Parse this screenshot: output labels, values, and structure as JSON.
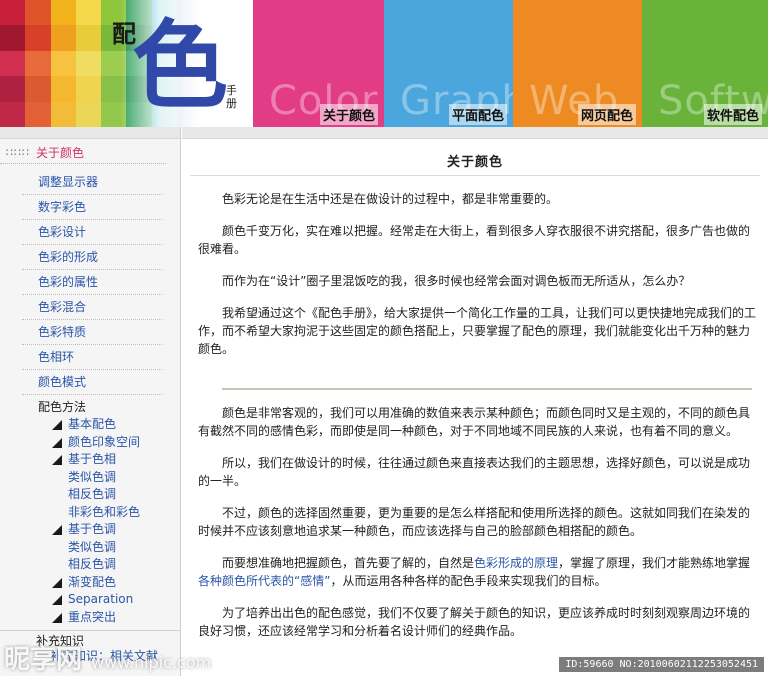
{
  "banner": {
    "logo": {
      "pei": "配",
      "se": "色",
      "shou": "手册"
    },
    "categories": [
      {
        "label": "关于颜色",
        "ghost": "Color",
        "color": "#e23c86"
      },
      {
        "label": "平面配色",
        "ghost": "Graphic",
        "color": "#4aa6dc"
      },
      {
        "label": "网页配色",
        "ghost": "Web",
        "color": "#ee8a22"
      },
      {
        "label": "软件配色",
        "ghost": "Software",
        "color": "#69b33a"
      }
    ]
  },
  "sidebar": {
    "current": "关于颜色",
    "items": [
      {
        "label": "调整显示器"
      },
      {
        "label": "数字彩色"
      },
      {
        "label": "色彩设计"
      },
      {
        "label": "色彩的形成"
      },
      {
        "label": "色彩的属性"
      },
      {
        "label": "色彩混合"
      },
      {
        "label": "色彩特质"
      },
      {
        "label": "色相环"
      },
      {
        "label": "颜色模式"
      }
    ],
    "section_title": "配色方法",
    "sub_items": [
      {
        "label": "基本配色",
        "level": 1
      },
      {
        "label": "颜色印象空间",
        "level": 1
      },
      {
        "label": "基于色相",
        "level": 1
      },
      {
        "label": "类似色调",
        "level": 2
      },
      {
        "label": "相反色调",
        "level": 2
      },
      {
        "label": "非彩色和彩色",
        "level": 2
      },
      {
        "label": "基于色调",
        "level": 1
      },
      {
        "label": "类似色调",
        "level": 2
      },
      {
        "label": "相反色调",
        "level": 2
      },
      {
        "label": "渐变配色",
        "level": 1
      },
      {
        "label": "Separation",
        "level": 1
      },
      {
        "label": "重点突出",
        "level": 1
      }
    ],
    "section2_title": "补充知识",
    "last_item": "补充知识：相关文献"
  },
  "main": {
    "title": "关于颜色",
    "paragraphs_top": [
      "色彩无论是在生活中还是在做设计的过程中，都是非常重要的。",
      "颜色千变万化，实在难以把握。经常走在大街上，看到很多人穿衣服很不讲究搭配，很多广告也做的很难看。",
      "而作为在“设计”圈子里混饭吃的我，很多时候也经常会面对调色板而无所适从，怎么办？",
      "我希望通过这个《配色手册》，给大家提供一个简化工作量的工具，让我们可以更快捷地完成我们的工作，而不希望大家拘泥于这些固定的颜色搭配上，只要掌握了配色的原理，我们就能变化出千万种的魅力颜色。"
    ],
    "paragraphs_bottom": [
      "颜色是非常客观的，我们可以用准确的数值来表示某种颜色；而颜色同时又是主观的，不同的颜色具有截然不同的感情色彩，而即使是同一种颜色，对于不同地域不同民族的人来说，也有着不同的意义。",
      "所以，我们在做设计的时候，往往通过颜色来直接表达我们的主题思想，选择好颜色，可以说是成功的一半。",
      "不过，颜色的选择固然重要，更为重要的是怎么样搭配和使用所选择的颜色。这就如同我们在染发的时候并不应该刻意地追求某一种颜色，而应该选择与自己的脸部颜色相搭配的颜色。"
    ],
    "para_link": {
      "before": "而要想准确地把握颜色，首先要了解的，自然是",
      "link1": "色彩形成的原理",
      "middle": "，掌握了原理，我们才能熟练地掌握",
      "link2": "各种颜色所代表的“感情”",
      "after": "，从而运用各种各样的配色手段来实现我们的目标。"
    },
    "para_last": "为了培养出出色的配色感觉，我们不仅要了解关于颜色的知识，更应该养成时时刻刻观察周边环境的良好习惯，还应该经常学习和分析着名设计师们的经典作品。"
  },
  "watermark": {
    "brand": "昵享网",
    "site": "www.nipic.com",
    "id_text": "ID:59660 NO:20100602112253052451"
  }
}
